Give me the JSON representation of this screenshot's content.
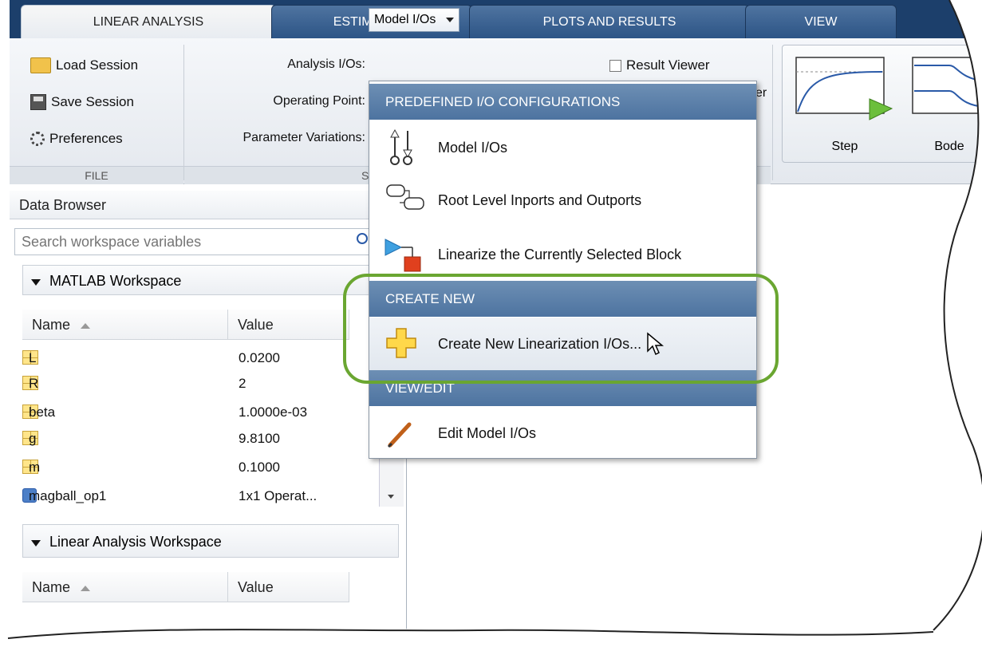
{
  "tabs": [
    {
      "label": "LINEAR ANALYSIS",
      "active": true
    },
    {
      "label": "ESTIMATION",
      "active": false
    },
    {
      "label": "PLOTS AND RESULTS",
      "active": false
    },
    {
      "label": "VIEW",
      "active": false
    }
  ],
  "file_section": {
    "load_session": "Load Session",
    "save_session": "Save Session",
    "preferences": "Preferences",
    "label": "FILE"
  },
  "setup_section": {
    "analysis_ios_label": "Analysis I/Os:",
    "analysis_ios_value": "Model I/Os",
    "operating_point_label": "Operating Point:",
    "parameter_variations_label": "Parameter Variations:",
    "label_fragment": "S",
    "result_viewer": "Result Viewer",
    "er_fragment": "er"
  },
  "plots": {
    "step": "Step",
    "bode": "Bode"
  },
  "data_browser": {
    "title": "Data Browser",
    "search_placeholder": "Search workspace variables",
    "matlab_workspace": "MATLAB Workspace",
    "linear_workspace": "Linear Analysis Workspace",
    "col_name": "Name",
    "col_value": "Value",
    "variables": [
      {
        "name": "L",
        "value": "0.0200"
      },
      {
        "name": "R",
        "value": "2"
      },
      {
        "name": "beta",
        "value": "1.0000e-03"
      },
      {
        "name": "g",
        "value": "9.8100"
      },
      {
        "name": "m",
        "value": "0.1000"
      },
      {
        "name": "magball_op1",
        "value": "1x1 Operat..."
      }
    ]
  },
  "menu": {
    "header1": "PREDEFINED I/O CONFIGURATIONS",
    "item_model_ios": "Model I/Os",
    "item_root_level": "Root Level Inports and Outports",
    "item_linearize_block": "Linearize the Currently Selected Block",
    "header2": "CREATE NEW",
    "item_create_new": "Create New Linearization I/Os...",
    "header3": "VIEW/EDIT",
    "item_edit": "Edit Model I/Os"
  },
  "colors": {
    "tab_bar": "#1c3f6b",
    "menu_header": "#5a7ea9",
    "highlight": "#6aa631"
  }
}
